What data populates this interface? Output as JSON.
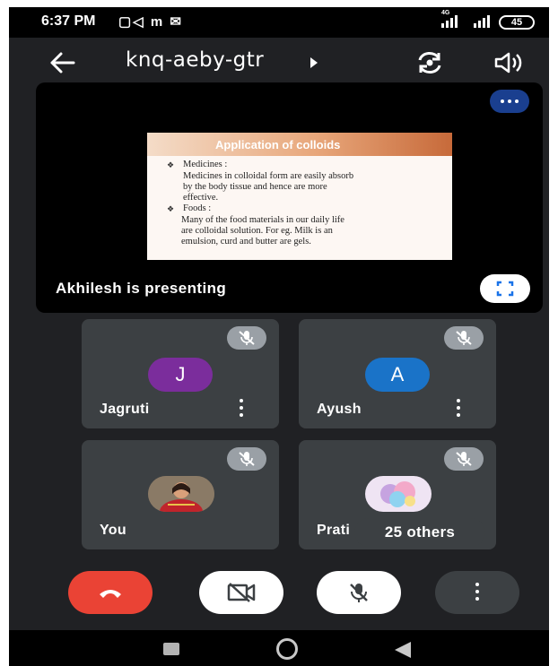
{
  "status_bar": {
    "time": "6:37 PM",
    "app_icons": "▢◁ m ✉",
    "network_type": "4G",
    "battery": "45"
  },
  "header": {
    "meeting_code": "knq-aeby-gtr"
  },
  "presentation": {
    "slide": {
      "title": "Application of colloids",
      "lines": [
        "Medicines :",
        "Medicines in colloidal form are easily absorb",
        "by the body tissue and hence are more",
        "effective.",
        "Foods :",
        "Many of the food materials in our daily life",
        "are colloidal solution. For eg. Milk is an",
        "emulsion, curd and butter are gels."
      ]
    },
    "presenting_label": "Akhilesh is presenting"
  },
  "participants": [
    {
      "name": "Jagruti",
      "initial": "J",
      "avatar_color": "#7b2d9c"
    },
    {
      "name": "Ayush",
      "initial": "A",
      "avatar_color": "#1a73c8"
    },
    {
      "name": "You"
    },
    {
      "name": "Prati"
    }
  ],
  "others_label": "25 others",
  "colors": {
    "background": "#202124",
    "tile": "#3c4043",
    "end_call": "#ea4335",
    "mute_chip": "#9aa0a6"
  },
  "icons": [
    "back-arrow-icon",
    "dropdown-caret-icon",
    "switch-camera-icon",
    "speaker-icon",
    "more-dots-icon",
    "fullscreen-icon",
    "mic-off-icon",
    "more-vert-icon",
    "end-call-icon",
    "camera-off-icon",
    "home-icon",
    "recents-icon",
    "back-nav-icon"
  ]
}
